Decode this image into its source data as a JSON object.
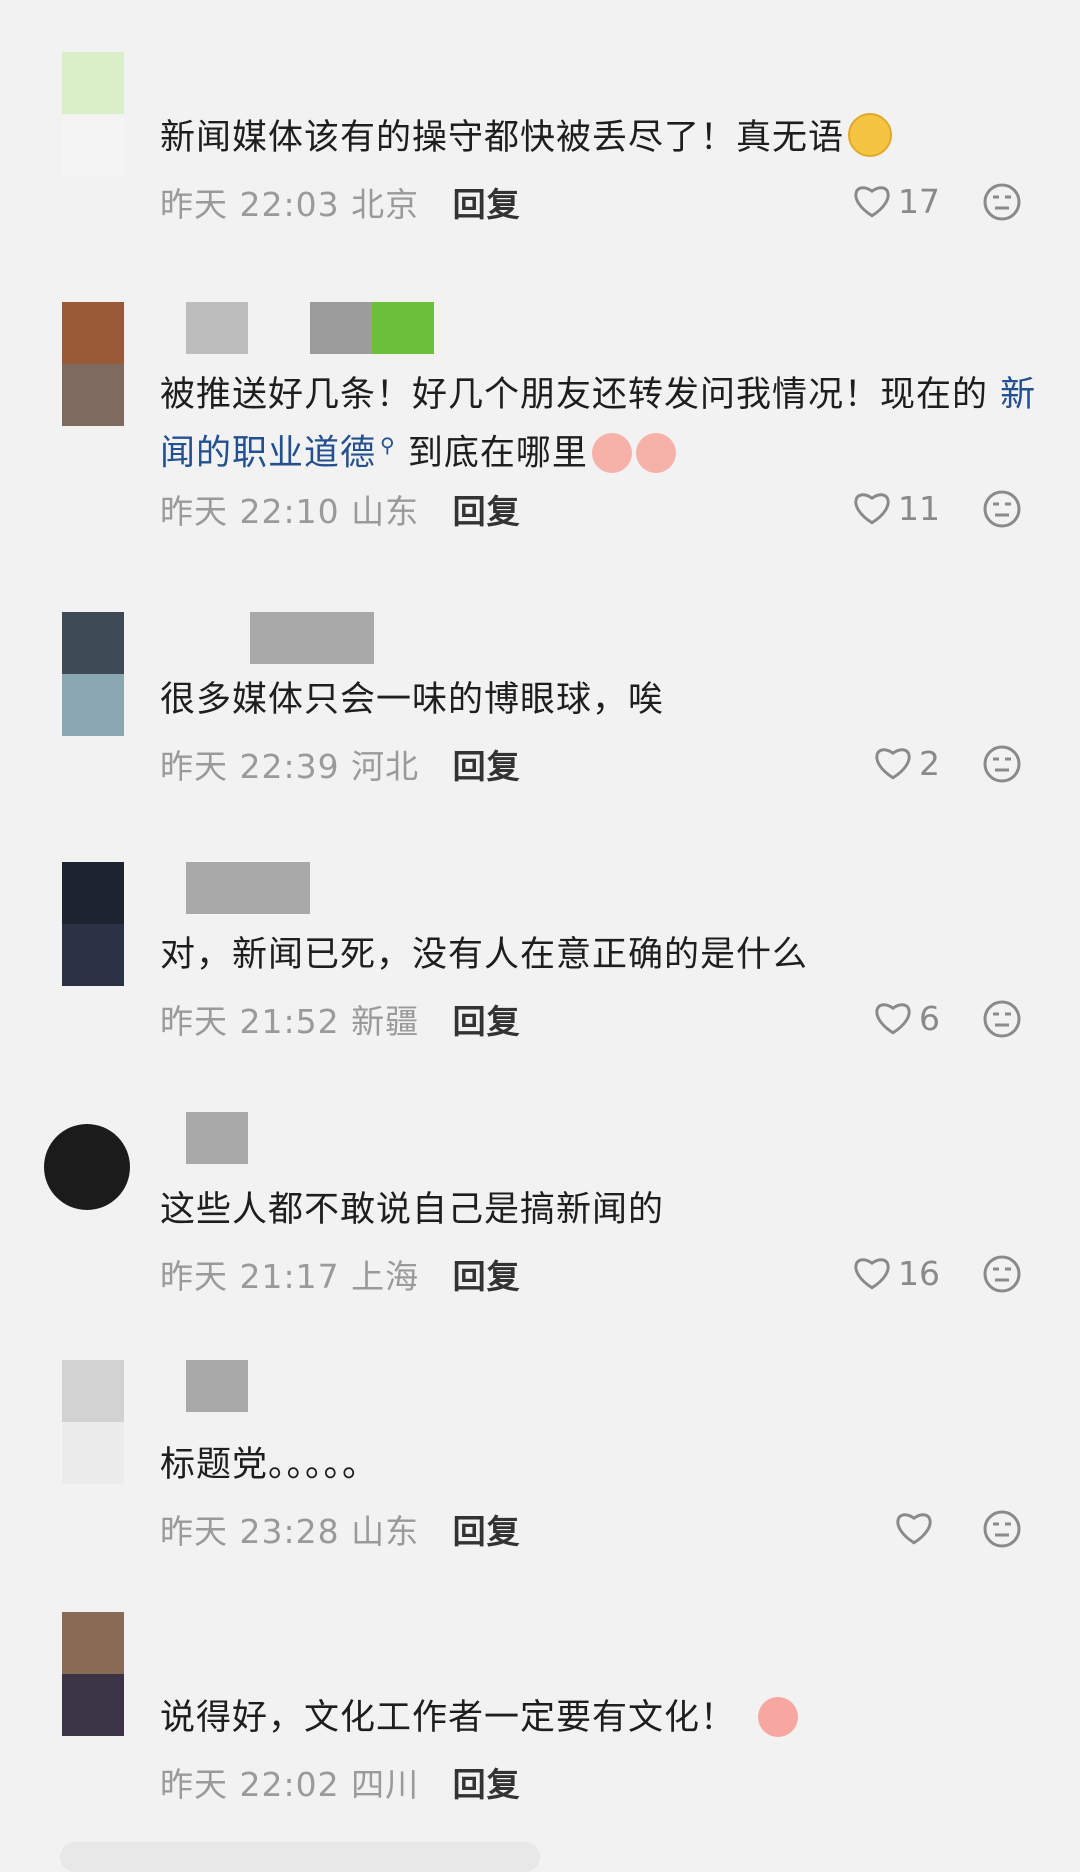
{
  "comments": [
    {
      "text": "新闻媒体该有的操守都快被丢尽了！真无语",
      "time": "昨天 22:03",
      "location": "北京",
      "reply_label": "回复",
      "likes": "17",
      "emoji": "unamused-face"
    },
    {
      "text_before": "被推送好几条！好几个朋友还转发问我情况！现在的",
      "tag": "新闻的职业道德",
      "text_after": "到底在哪里",
      "time": "昨天 22:10",
      "location": "山东",
      "reply_label": "回复",
      "likes": "11",
      "emoji": "peach-face x2"
    },
    {
      "text": "很多媒体只会一味的博眼球，唉",
      "time": "昨天 22:39",
      "location": "河北",
      "reply_label": "回复",
      "likes": "2"
    },
    {
      "text": "对，新闻已死，没有人在意正确的是什么",
      "time": "昨天 21:52",
      "location": "新疆",
      "reply_label": "回复",
      "likes": "6"
    },
    {
      "text": "这些人都不敢说自己是搞新闻的",
      "time": "昨天 21:17",
      "location": "上海",
      "reply_label": "回复",
      "likes": "16"
    },
    {
      "text": "标题党。。。。。",
      "time": "昨天 23:28",
      "location": "山东",
      "reply_label": "回复",
      "likes": ""
    },
    {
      "text": "说得好，文化工作者一定要有文化！",
      "time": "昨天 22:02",
      "location": "四川",
      "reply_label": "回复",
      "emoji": "shocked-peach-face"
    }
  ]
}
